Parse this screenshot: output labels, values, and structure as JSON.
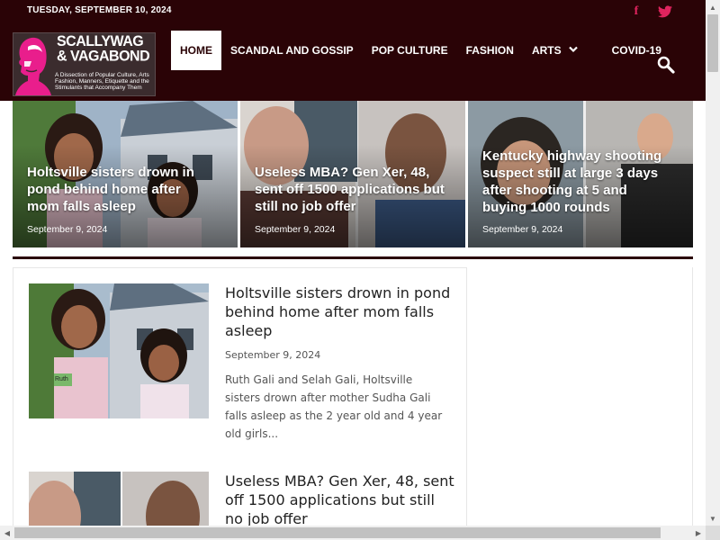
{
  "header": {
    "date": "TUESDAY, SEPTEMBER 10, 2024",
    "social": {
      "facebook_glyph": "f",
      "facebook_icon": "facebook-icon",
      "twitter_icon": "twitter-icon"
    },
    "logo": {
      "title_line1": "SCALLYWAG",
      "title_line2": "& VAGABOND",
      "tagline": "A Dissection of Popular Culture, Arts Fashion, Manners, Etiquette and the Stimulants that Accompany Them"
    },
    "nav": [
      {
        "label": "HOME",
        "active": true
      },
      {
        "label": "SCANDAL AND GOSSIP"
      },
      {
        "label": "POP CULTURE"
      },
      {
        "label": "FASHION"
      },
      {
        "label": "ARTS",
        "chevron": "❯"
      },
      {
        "label": "COVID-19"
      }
    ],
    "search_icon": "search-icon"
  },
  "hero": [
    {
      "title": "Holtsville sisters drown in pond behind home after mom falls asleep",
      "date": "September 9, 2024"
    },
    {
      "title": "Useless MBA? Gen Xer, 48, sent off 1500 applications but still no job offer",
      "date": "September 9, 2024"
    },
    {
      "title": "Kentucky highway shooting suspect still at large 3 days after shooting at 5 and buying 1000 rounds",
      "date": "September 9, 2024"
    }
  ],
  "posts": [
    {
      "title": "Holtsville sisters drown in pond behind home after mom falls asleep",
      "date": "September 9, 2024",
      "excerpt": "Ruth Gali and Selah Gali, Holtsville sisters drown after mother Sudha Gali falls asleep as the 2 year old and 4 year old girls...",
      "badge": "Ruth"
    },
    {
      "title": "Useless MBA? Gen Xer, 48, sent off 1500 applications but still no job offer"
    }
  ],
  "colors": {
    "header_bg": "#2a0306",
    "social_accent": "#e0245e"
  }
}
